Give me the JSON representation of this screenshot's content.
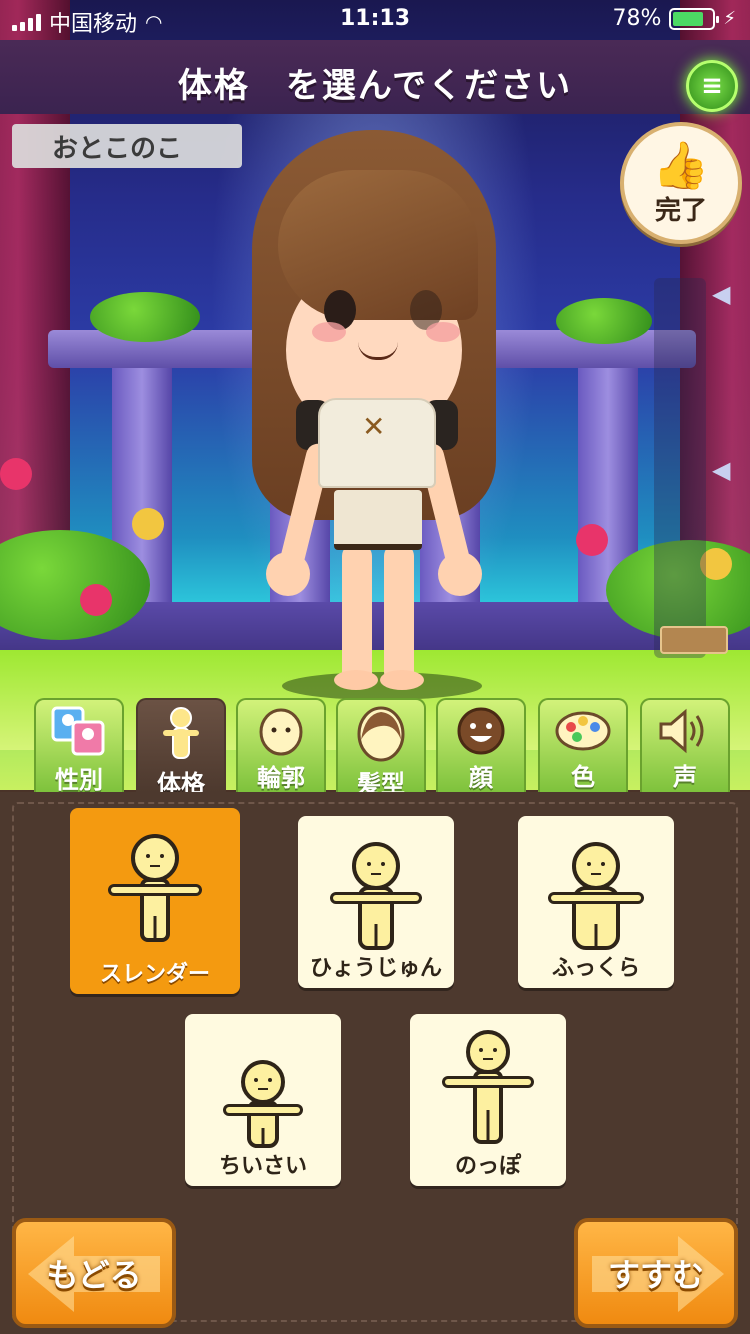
{
  "status_bar": {
    "carrier": "中国移动",
    "time": "11:13",
    "battery": "78%"
  },
  "header": {
    "title": "体格　を選んでください",
    "menu_icon": "menu-icon"
  },
  "gender_label": "おとこのこ",
  "done_button": {
    "label": "完了",
    "icon": "thumbs-up-icon"
  },
  "tabs": [
    {
      "label": "性別",
      "icon": "gender-icon",
      "active": false
    },
    {
      "label": "体格",
      "icon": "body-icon",
      "active": true
    },
    {
      "label": "輪郭",
      "icon": "face-outline-icon",
      "active": false
    },
    {
      "label": "髪型",
      "icon": "hairstyle-icon",
      "active": false
    },
    {
      "label": "顔",
      "icon": "face-icon",
      "active": false
    },
    {
      "label": "色",
      "icon": "palette-icon",
      "active": false
    },
    {
      "label": "声",
      "icon": "speaker-icon",
      "active": false
    }
  ],
  "body_options": [
    {
      "label": "スレンダー",
      "selected": true
    },
    {
      "label": "ひょうじゅん",
      "selected": false
    },
    {
      "label": "ふっくら",
      "selected": false
    },
    {
      "label": "ちいさい",
      "selected": false
    },
    {
      "label": "のっぽ",
      "selected": false
    }
  ],
  "nav": {
    "back_label": "もどる",
    "next_label": "すすむ"
  },
  "colors": {
    "selected": "#f49a10",
    "option_bg": "#fffae0",
    "panel_bg": "#4d392e",
    "tab_bg": "#a8dc50",
    "button_orange": "#f08a10"
  }
}
